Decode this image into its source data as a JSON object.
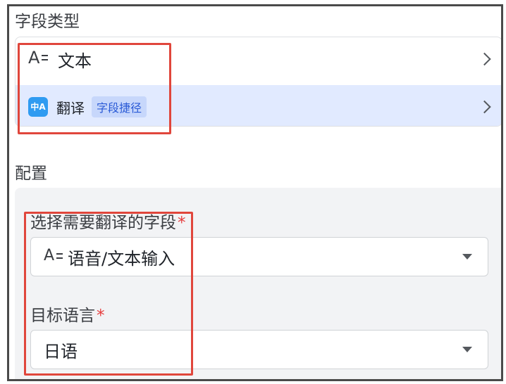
{
  "field_type_section": {
    "title": "字段类型"
  },
  "field_types": [
    {
      "label": "文本",
      "icon": "text-type-icon",
      "selected": false
    },
    {
      "label": "翻译",
      "icon": "translate-icon",
      "icon_text": "中A",
      "badge": "字段捷径",
      "selected": true
    }
  ],
  "config_section": {
    "title": "配置"
  },
  "config_fields": {
    "source_field": {
      "label": "选择需要翻译的字段",
      "required_mark": "*",
      "value": "语音/文本输入",
      "value_icon": "text-type-icon"
    },
    "target_language": {
      "label": "目标语言",
      "required_mark": "*",
      "value": "日语"
    }
  },
  "colors": {
    "selected_row_bg": "#e1eaff",
    "badge_bg": "#c7d7fb",
    "badge_text": "#2a5ad6",
    "required": "#e63c3c",
    "annotation": "#e0463c",
    "translate_icon_bg": "#2f9bf1"
  }
}
